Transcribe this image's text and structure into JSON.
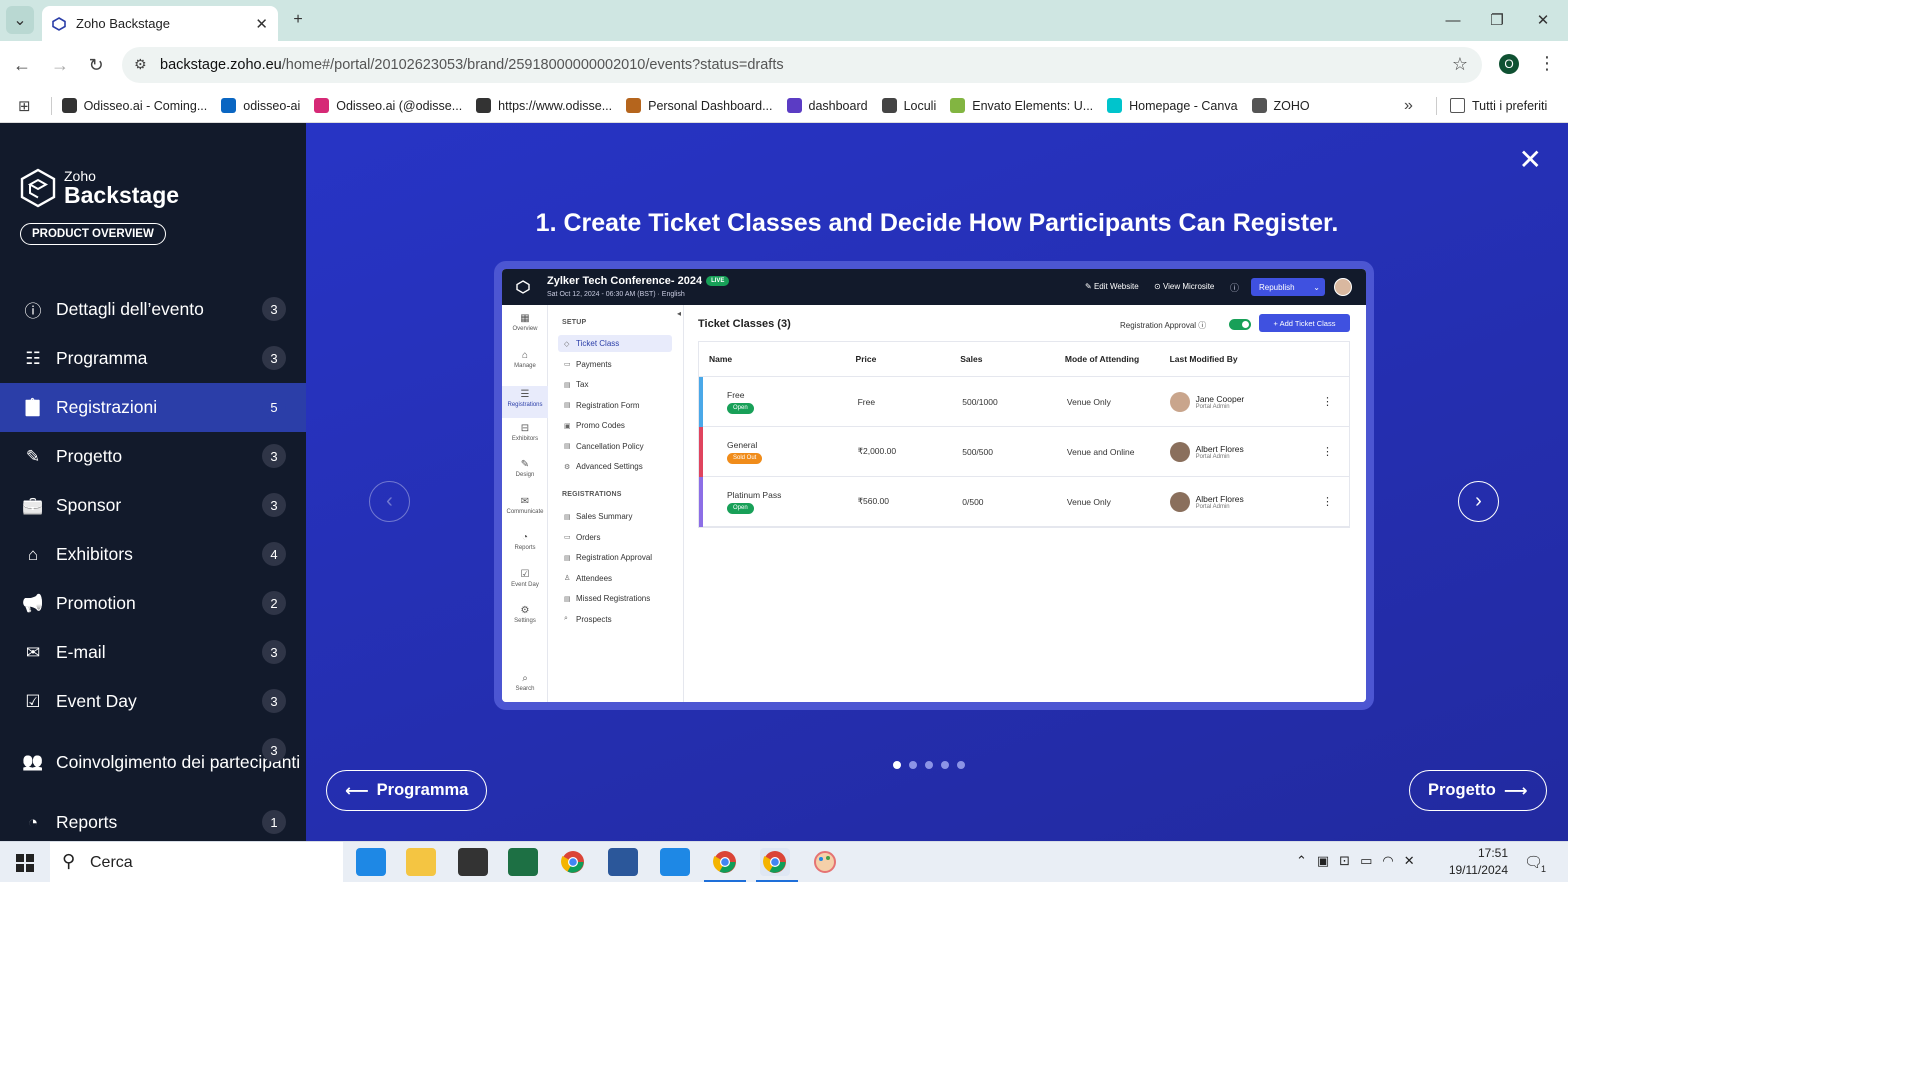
{
  "browser": {
    "tab_title": "Zoho Backstage",
    "url_host": "backstage.zoho.eu",
    "url_path": "/home#/portal/20102623053/brand/25918000000002010/events?status=drafts",
    "profile_initial": "O",
    "bookmarks": [
      {
        "label": "Odisseo.ai - Coming...",
        "color": "#333333"
      },
      {
        "label": "odisseo-ai",
        "color": "#0a66c2"
      },
      {
        "label": "Odisseo.ai (@odisse...",
        "color": "#d62976"
      },
      {
        "label": "https://www.odisse...",
        "color": "#333333"
      },
      {
        "label": "Personal Dashboard...",
        "color": "#b5651d"
      },
      {
        "label": "dashboard",
        "color": "#5b3cc4"
      },
      {
        "label": "Loculi",
        "color": "#444444"
      },
      {
        "label": "Envato Elements: U...",
        "color": "#82b541"
      },
      {
        "label": "Homepage - Canva",
        "color": "#00c4cc"
      },
      {
        "label": "ZOHO",
        "color": "#555555"
      }
    ],
    "all_bookmarks": "Tutti i preferiti",
    "more": "»"
  },
  "sidebar": {
    "brand_small": "Zoho",
    "brand_big": "Backstage",
    "product_overview": "PRODUCT OVERVIEW",
    "items": [
      {
        "label": "Dettagli dell’evento",
        "count": "3",
        "icon": "info-icon"
      },
      {
        "label": "Programma",
        "count": "3",
        "icon": "list-icon"
      },
      {
        "label": "Registrazioni",
        "count": "5",
        "icon": "clipboard-icon",
        "active": true
      },
      {
        "label": "Progetto",
        "count": "3",
        "icon": "design-icon"
      },
      {
        "label": "Sponsor",
        "count": "3",
        "icon": "briefcase-icon"
      },
      {
        "label": "Exhibitors",
        "count": "4",
        "icon": "booth-icon"
      },
      {
        "label": "Promotion",
        "count": "2",
        "icon": "megaphone-icon"
      },
      {
        "label": "E-mail",
        "count": "3",
        "icon": "mail-icon"
      },
      {
        "label": "Event Day",
        "count": "3",
        "icon": "calendar-check-icon"
      },
      {
        "label": "Coinvolgimento dei partecipanti",
        "count": "3",
        "icon": "users-icon"
      },
      {
        "label": "Reports",
        "count": "1",
        "icon": "chart-pie-icon"
      }
    ]
  },
  "slide": {
    "title": "1. Create Ticket Classes and Decide How Participants Can Register.",
    "prev_label": "Programma",
    "next_label": "Progetto",
    "dots": 5,
    "active_dot": 0
  },
  "inner": {
    "event_title": "Zylker Tech Conference- 2024",
    "live_badge": "LIVE",
    "event_meta": "Sat Oct 12, 2024 - 06:30 AM (BST)  ·  English",
    "edit_website": "Edit Website",
    "view_microsite": "View Microsite",
    "republish": "Republish",
    "left_icons": [
      "Overview",
      "Manage",
      "Registrations",
      "Exhibitors",
      "Design",
      "Communicate",
      "Reports",
      "Event Day",
      "Settings"
    ],
    "search": "Search",
    "setup_label": "SETUP",
    "setup_items": [
      "Ticket Class",
      "Payments",
      "Tax",
      "Registration Form",
      "Promo Codes",
      "Cancellation Policy",
      "Advanced Settings"
    ],
    "registrations_label": "REGISTRATIONS",
    "registration_items": [
      "Sales Summary",
      "Orders",
      "Registration Approval",
      "Attendees",
      "Missed Registrations",
      "Prospects"
    ],
    "table_title": "Ticket Classes (3)",
    "approval_label": "Registration Approval",
    "add_button": "+ Add Ticket Class",
    "columns": [
      "Name",
      "Price",
      "Sales",
      "Mode of Attending",
      "Last Modified By"
    ],
    "rows": [
      {
        "name": "Free",
        "status": "Open",
        "status_color": "#18a058",
        "bar": "#4aa8e8",
        "price": "Free",
        "sales": "500/1000",
        "mode": "Venue Only",
        "by": "Jane Cooper",
        "role": "Portal Admin"
      },
      {
        "name": "General",
        "status": "Sold Out",
        "status_color": "#f08c1a",
        "bar": "#e0445e",
        "price": "₹2,000.00",
        "sales": "500/500",
        "mode": "Venue and Online",
        "by": "Albert Flores",
        "role": "Portal Admin"
      },
      {
        "name": "Platinum Pass",
        "status": "Open",
        "status_color": "#18a058",
        "bar": "#8c6ee6",
        "price": "₹560.00",
        "sales": "0/500",
        "mode": "Venue Only",
        "by": "Albert Flores",
        "role": "Portal Admin"
      }
    ]
  },
  "taskbar": {
    "search_placeholder": "Cerca",
    "time": "17:51",
    "date": "19/11/2024",
    "notif_count": "1"
  }
}
